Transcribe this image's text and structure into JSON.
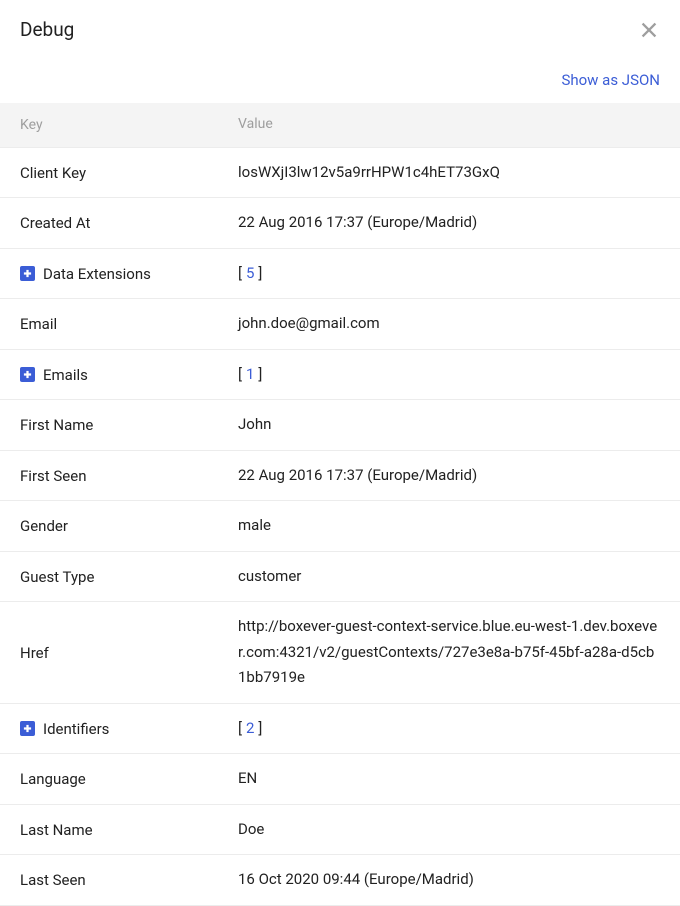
{
  "header": {
    "title": "Debug",
    "json_link": "Show as JSON"
  },
  "table": {
    "key_header": "Key",
    "value_header": "Value",
    "rows": [
      {
        "key": "Client Key",
        "value": "losWXjI3lw12v5a9rrHPW1c4hET73GxQ",
        "expandable": false
      },
      {
        "key": "Created At",
        "value": "22 Aug 2016 17:37 (Europe/Madrid)",
        "expandable": false
      },
      {
        "key": "Data Extensions",
        "count": "5",
        "expandable": true
      },
      {
        "key": "Email",
        "value": "john.doe@gmail.com",
        "expandable": false
      },
      {
        "key": "Emails",
        "count": "1",
        "expandable": true
      },
      {
        "key": "First Name",
        "value": "John",
        "expandable": false
      },
      {
        "key": "First Seen",
        "value": "22 Aug 2016 17:37 (Europe/Madrid)",
        "expandable": false
      },
      {
        "key": "Gender",
        "value": "male",
        "expandable": false
      },
      {
        "key": "Guest Type",
        "value": "customer",
        "expandable": false
      },
      {
        "key": "Href",
        "value": "http://boxever-guest-context-service.blue.eu-west-1.dev.boxever.com:4321/v2/guestContexts/727e3e8a-b75f-45bf-a28a-d5cb1bb7919e",
        "expandable": false,
        "multiline": true
      },
      {
        "key": "Identifiers",
        "count": "2",
        "expandable": true
      },
      {
        "key": "Language",
        "value": "EN",
        "expandable": false
      },
      {
        "key": "Last Name",
        "value": "Doe",
        "expandable": false
      },
      {
        "key": "Last Seen",
        "value": "16 Oct 2020 09:44 (Europe/Madrid)",
        "expandable": false
      }
    ]
  }
}
